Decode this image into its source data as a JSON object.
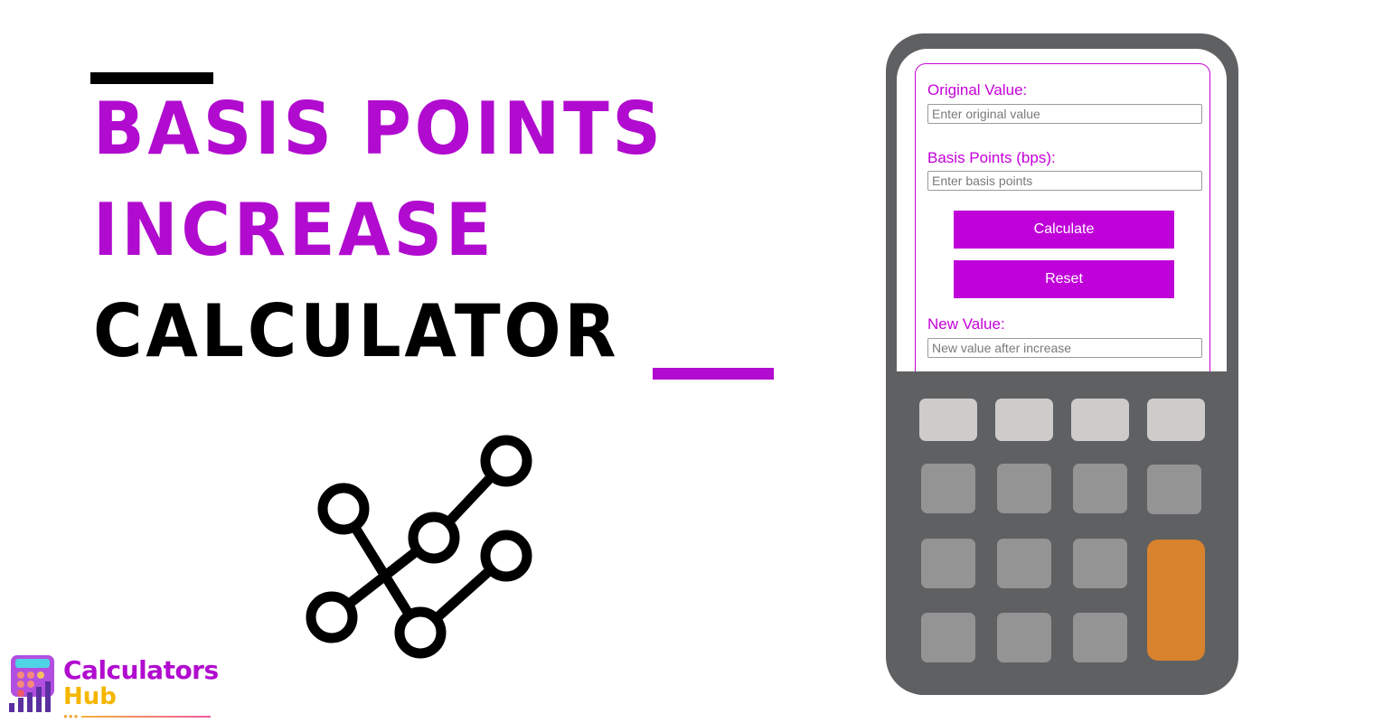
{
  "title": {
    "line1": "BASIS POINTS",
    "line2": "INCREASE",
    "line3": "CALCULATOR"
  },
  "icon": "data-graph-nodes-icon",
  "calculator_form": {
    "original_value_label": "Original Value:",
    "original_value_placeholder": "Enter original value",
    "original_value": "",
    "basis_points_label": "Basis Points (bps):",
    "basis_points_placeholder": "Enter basis points",
    "basis_points": "",
    "calculate_label": "Calculate",
    "reset_label": "Reset",
    "new_value_label": "New Value:",
    "new_value_placeholder": "New value after increase",
    "new_value": ""
  },
  "logo": {
    "line1": "Calculators",
    "line2": "Hub"
  },
  "colors": {
    "accent": "#b10bcf",
    "button": "#c000d9",
    "calculator_body": "#5f6062",
    "key_light": "#cdcccb",
    "key_mid": "#949494",
    "key_orange": "#d9832f"
  }
}
